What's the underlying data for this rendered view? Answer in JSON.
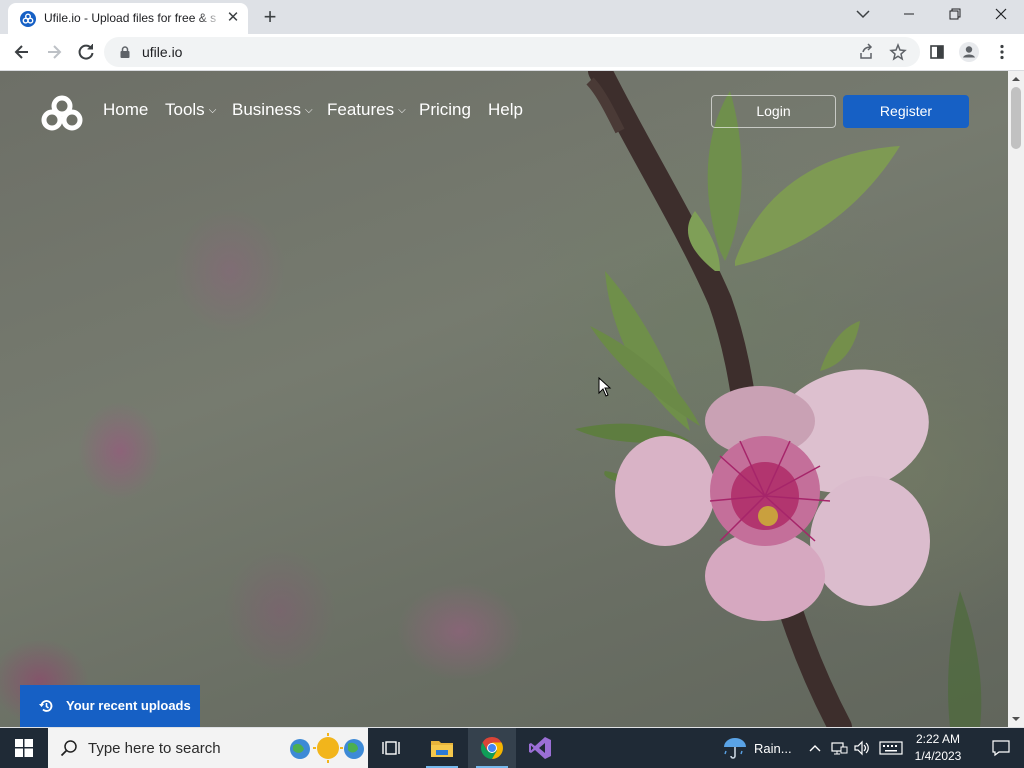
{
  "browser": {
    "tab_title": "Ufile.io - Upload files for free & s",
    "url": "ufile.io"
  },
  "site": {
    "nav": {
      "home": "Home",
      "tools": "Tools",
      "business": "Business",
      "features": "Features",
      "pricing": "Pricing",
      "help": "Help"
    },
    "login": "Login",
    "register": "Register",
    "recent_uploads": "Your recent uploads"
  },
  "taskbar": {
    "search_placeholder": "Type here to search",
    "weather": "Rain...",
    "time": "2:22 AM",
    "date": "1/4/2023"
  },
  "colors": {
    "brand_blue": "#1660c5",
    "taskbar": "#1f2a36"
  }
}
